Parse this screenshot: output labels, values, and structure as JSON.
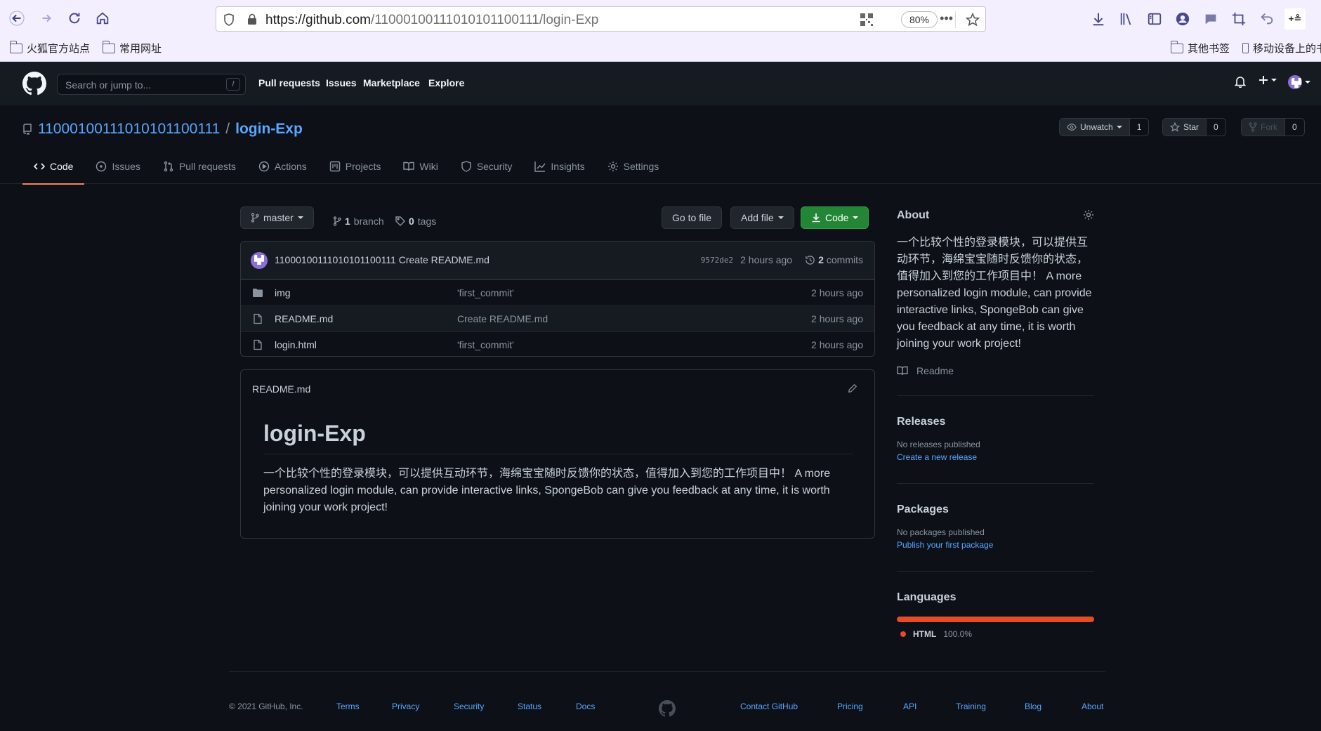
{
  "browser": {
    "url_host": "https://github.com",
    "url_path": "/11000100111010101100111/login-Exp",
    "zoom": "80%",
    "bookmarks": [
      "火狐官方站点",
      "常用网址"
    ],
    "bookmarks_right": [
      "其他书签",
      "移动设备上的书"
    ]
  },
  "github_header": {
    "search_placeholder": "Search or jump to...",
    "search_shortcut": "/",
    "nav": [
      "Pull requests",
      "Issues",
      "Marketplace",
      "Explore"
    ]
  },
  "repo": {
    "owner": "11000100111010101100111",
    "separator": "/",
    "name": "login-Exp",
    "unwatch_label": "Unwatch",
    "watch_count": "1",
    "star_label": "Star",
    "star_count": "0",
    "fork_label": "Fork",
    "fork_count": "0",
    "tabs": [
      "Code",
      "Issues",
      "Pull requests",
      "Actions",
      "Projects",
      "Wiki",
      "Security",
      "Insights",
      "Settings"
    ]
  },
  "toolbar": {
    "branch": "master",
    "branch_count": "1",
    "branch_label": "branch",
    "tag_count": "0",
    "tag_label": "tags",
    "go_to_file": "Go to file",
    "add_file": "Add file",
    "code": "Code"
  },
  "commit": {
    "author": "11000100111010101100111",
    "message": "Create README.md",
    "sha": "9572de2",
    "age": "2 hours ago",
    "commit_count": "2",
    "commit_label": "commits"
  },
  "files": [
    {
      "type": "folder",
      "name": "img",
      "message": "'first_commit'",
      "age": "2 hours ago"
    },
    {
      "type": "file",
      "name": "README.md",
      "message": "Create README.md",
      "age": "2 hours ago"
    },
    {
      "type": "file",
      "name": "login.html",
      "message": "'first_commit'",
      "age": "2 hours ago"
    }
  ],
  "readme": {
    "filename": "README.md",
    "heading": "login-Exp",
    "body": "一个比较个性的登录模块，可以提供互动环节，海绵宝宝随时反馈你的状态，值得加入到您的工作项目中！ A more personalized login module, can provide interactive links, SpongeBob can give you feedback at any time, it is worth joining your work project!"
  },
  "sidebar": {
    "about_title": "About",
    "about_text": "一个比较个性的登录模块，可以提供互动环节，海绵宝宝随时反馈你的状态，值得加入到您的工作项目中！ A more personalized login module, can provide interactive links, SpongeBob can give you feedback at any time, it is worth joining your work project!",
    "readme_link": "Readme",
    "releases_title": "Releases",
    "releases_empty": "No releases published",
    "releases_link": "Create a new release",
    "packages_title": "Packages",
    "packages_empty": "No packages published",
    "packages_link": "Publish your first package",
    "languages_title": "Languages",
    "language_name": "HTML",
    "language_percent": "100.0%",
    "language_color": "#e34c26",
    "language_fraction": 1.0
  },
  "footer": {
    "copyright": "© 2021 GitHub, Inc.",
    "left_links": [
      "Terms",
      "Privacy",
      "Security",
      "Status",
      "Docs"
    ],
    "right_links": [
      "Contact GitHub",
      "Pricing",
      "API",
      "Training",
      "Blog",
      "About"
    ]
  }
}
